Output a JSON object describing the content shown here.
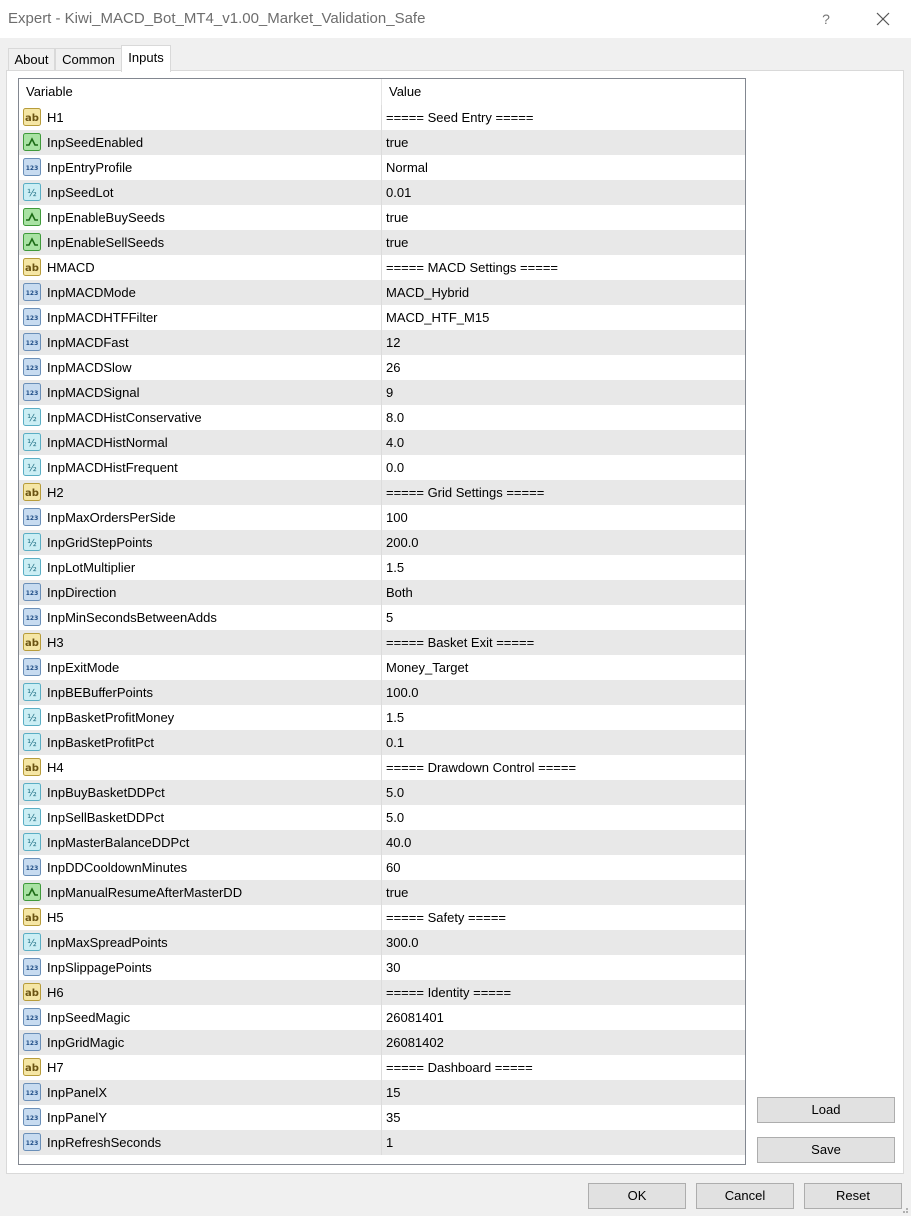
{
  "window": {
    "title": "Expert - Kiwi_MACD_Bot_MT4_v1.00_Market_Validation_Safe",
    "help_glyph": "?"
  },
  "tabs": [
    {
      "label": "About"
    },
    {
      "label": "Common"
    },
    {
      "label": "Inputs"
    }
  ],
  "grid": {
    "col_variable": "Variable",
    "col_value": "Value",
    "rows": [
      {
        "type": "ab",
        "name": "H1",
        "value": "===== Seed Entry ====="
      },
      {
        "type": "bool",
        "name": "InpSeedEnabled",
        "value": "true"
      },
      {
        "type": "int",
        "name": "InpEntryProfile",
        "value": "Normal"
      },
      {
        "type": "dbl",
        "name": "InpSeedLot",
        "value": "0.01"
      },
      {
        "type": "bool",
        "name": "InpEnableBuySeeds",
        "value": "true"
      },
      {
        "type": "bool",
        "name": "InpEnableSellSeeds",
        "value": "true"
      },
      {
        "type": "ab",
        "name": "HMACD",
        "value": "===== MACD Settings ====="
      },
      {
        "type": "int",
        "name": "InpMACDMode",
        "value": "MACD_Hybrid"
      },
      {
        "type": "int",
        "name": "InpMACDHTFFilter",
        "value": "MACD_HTF_M15"
      },
      {
        "type": "int",
        "name": "InpMACDFast",
        "value": "12"
      },
      {
        "type": "int",
        "name": "InpMACDSlow",
        "value": "26"
      },
      {
        "type": "int",
        "name": "InpMACDSignal",
        "value": "9"
      },
      {
        "type": "dbl",
        "name": "InpMACDHistConservative",
        "value": "8.0"
      },
      {
        "type": "dbl",
        "name": "InpMACDHistNormal",
        "value": "4.0"
      },
      {
        "type": "dbl",
        "name": "InpMACDHistFrequent",
        "value": "0.0"
      },
      {
        "type": "ab",
        "name": "H2",
        "value": "===== Grid Settings ====="
      },
      {
        "type": "int",
        "name": "InpMaxOrdersPerSide",
        "value": "100"
      },
      {
        "type": "dbl",
        "name": "InpGridStepPoints",
        "value": "200.0"
      },
      {
        "type": "dbl",
        "name": "InpLotMultiplier",
        "value": "1.5"
      },
      {
        "type": "int",
        "name": "InpDirection",
        "value": "Both"
      },
      {
        "type": "int",
        "name": "InpMinSecondsBetweenAdds",
        "value": "5"
      },
      {
        "type": "ab",
        "name": "H3",
        "value": "===== Basket Exit ====="
      },
      {
        "type": "int",
        "name": "InpExitMode",
        "value": "Money_Target"
      },
      {
        "type": "dbl",
        "name": "InpBEBufferPoints",
        "value": "100.0"
      },
      {
        "type": "dbl",
        "name": "InpBasketProfitMoney",
        "value": "1.5"
      },
      {
        "type": "dbl",
        "name": "InpBasketProfitPct",
        "value": "0.1"
      },
      {
        "type": "ab",
        "name": "H4",
        "value": "===== Drawdown Control ====="
      },
      {
        "type": "dbl",
        "name": "InpBuyBasketDDPct",
        "value": "5.0"
      },
      {
        "type": "dbl",
        "name": "InpSellBasketDDPct",
        "value": "5.0"
      },
      {
        "type": "dbl",
        "name": "InpMasterBalanceDDPct",
        "value": "40.0"
      },
      {
        "type": "int",
        "name": "InpDDCooldownMinutes",
        "value": "60"
      },
      {
        "type": "bool",
        "name": "InpManualResumeAfterMasterDD",
        "value": "true"
      },
      {
        "type": "ab",
        "name": "H5",
        "value": "===== Safety ====="
      },
      {
        "type": "dbl",
        "name": "InpMaxSpreadPoints",
        "value": "300.0"
      },
      {
        "type": "int",
        "name": "InpSlippagePoints",
        "value": "30"
      },
      {
        "type": "ab",
        "name": "H6",
        "value": "===== Identity ====="
      },
      {
        "type": "int",
        "name": "InpSeedMagic",
        "value": "26081401"
      },
      {
        "type": "int",
        "name": "InpGridMagic",
        "value": "26081402"
      },
      {
        "type": "ab",
        "name": "H7",
        "value": "===== Dashboard ====="
      },
      {
        "type": "int",
        "name": "InpPanelX",
        "value": "15"
      },
      {
        "type": "int",
        "name": "InpPanelY",
        "value": "35"
      },
      {
        "type": "int",
        "name": "InpRefreshSeconds",
        "value": "1"
      }
    ]
  },
  "icon_names": {
    "ab": "string-type-icon",
    "bool": "bool-type-icon",
    "int": "integer-type-icon",
    "dbl": "double-type-icon"
  },
  "icon_glyphs": {
    "ab": "ab",
    "int": "123",
    "dbl": "½"
  },
  "side_buttons": {
    "load": "Load",
    "save": "Save"
  },
  "footer_buttons": {
    "ok": "OK",
    "cancel": "Cancel",
    "reset": "Reset"
  },
  "colors": {
    "row_alt": "#e8e8e8",
    "ab_icon_bg": "#f5e6a5",
    "bool_icon_bg": "#a9e2a3",
    "int_icon_bg": "#c7dbf0",
    "dbl_icon_bg": "#cbeef4"
  }
}
